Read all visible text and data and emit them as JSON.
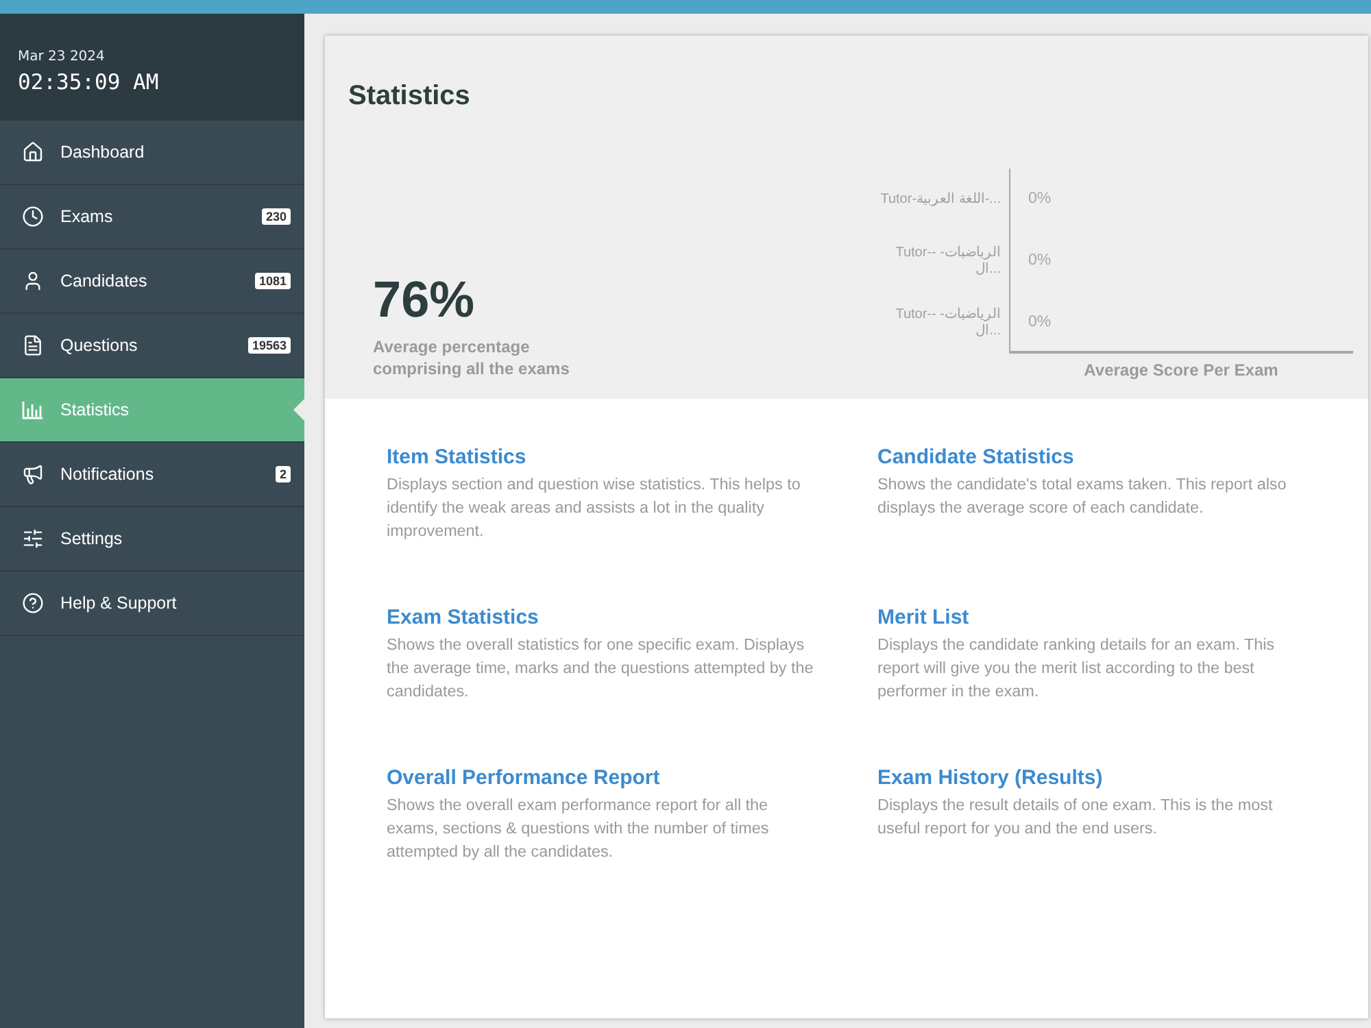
{
  "sidebar": {
    "date": "Mar 23 2024",
    "time": "02:35:09 AM",
    "items": [
      {
        "label": "Dashboard",
        "selected": false
      },
      {
        "label": "Exams",
        "badge": "230",
        "selected": false
      },
      {
        "label": "Candidates",
        "badge": "1081",
        "selected": false
      },
      {
        "label": "Questions",
        "badge": "19563",
        "selected": false
      },
      {
        "label": "Statistics",
        "selected": true
      },
      {
        "label": "Notifications",
        "badge": "2",
        "selected": false
      },
      {
        "label": "Settings",
        "selected": false
      },
      {
        "label": "Help & Support",
        "selected": false
      }
    ]
  },
  "page": {
    "title": "Statistics"
  },
  "summary": {
    "value": "76%",
    "caption": "Average percentage comprising all the exams"
  },
  "score_chart": {
    "axis_title": "Average Score Per Exam",
    "exams": [
      {
        "name": "Tutor-اللغة العربية-...",
        "score": "0%"
      },
      {
        "name": "Tutor-- الرياضيات- ال...",
        "score": "0%"
      },
      {
        "name": "Tutor-- الرياضيات- ال...",
        "score": "0%"
      }
    ]
  },
  "reports": [
    {
      "title": "Item Statistics",
      "description": "Displays section and question wise statistics. This helps to identify the weak areas and assists a lot in the quality improvement."
    },
    {
      "title": "Candidate Statistics",
      "description": "Shows the candidate's total exams taken. This report also displays the average score of each candidate."
    },
    {
      "title": "Exam Statistics",
      "description": "Shows the overall statistics for one specific exam. Displays the average time, marks and the questions attempted by the candidates."
    },
    {
      "title": "Merit List",
      "description": "Displays the candidate ranking details for an exam. This report will give you the merit list according to the best performer in the exam."
    },
    {
      "title": "Overall Performance Report",
      "description": "Shows the overall exam performance report for all the exams, sections & questions with the number of times attempted by all the candidates."
    },
    {
      "title": "Exam History (Results)",
      "description": "Displays the result details of one exam. This is the most useful report for you and the end users."
    }
  ]
}
